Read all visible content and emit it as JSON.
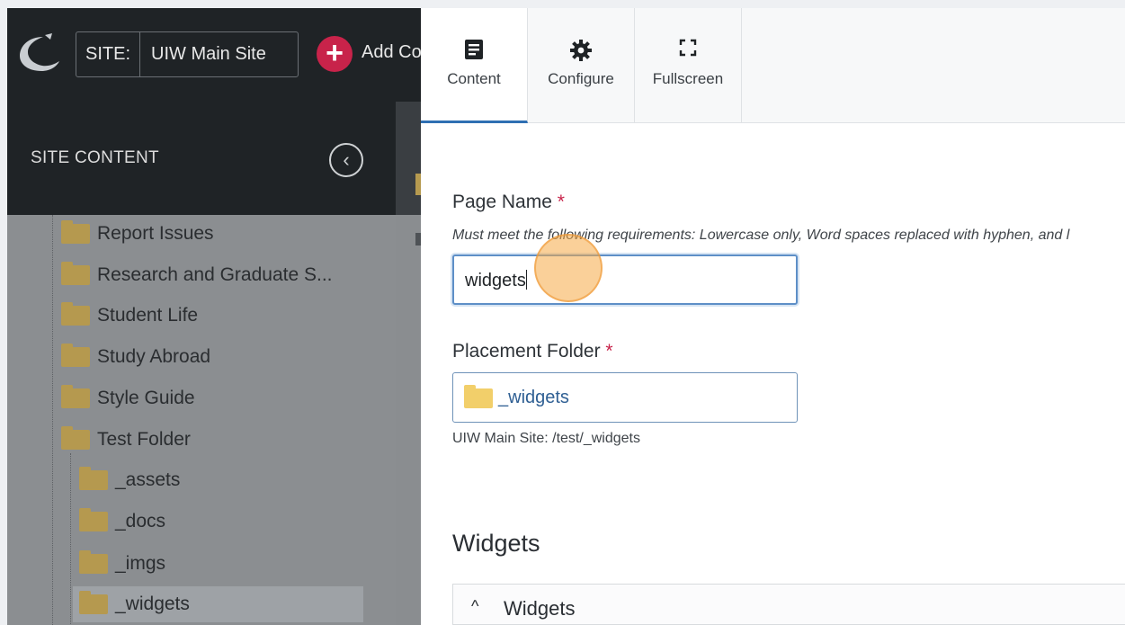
{
  "topbar": {
    "site_prefix": "SITE:",
    "site_name": "UIW Main Site",
    "add_label": "Add Content"
  },
  "site_content": {
    "title": "SITE CONTENT",
    "items": [
      {
        "label": "Report Issues",
        "level": 1,
        "selected": false
      },
      {
        "label": "Research and Graduate S...",
        "level": 1,
        "selected": false
      },
      {
        "label": "Student Life",
        "level": 1,
        "selected": false
      },
      {
        "label": "Study Abroad",
        "level": 1,
        "selected": false
      },
      {
        "label": "Style Guide",
        "level": 1,
        "selected": false
      },
      {
        "label": "Test Folder",
        "level": 1,
        "selected": false
      },
      {
        "label": "_assets",
        "level": 2,
        "selected": false
      },
      {
        "label": "_docs",
        "level": 2,
        "selected": false
      },
      {
        "label": "_imgs",
        "level": 2,
        "selected": false
      },
      {
        "label": "_widgets",
        "level": 2,
        "selected": true
      }
    ]
  },
  "panel": {
    "tabs": [
      {
        "label": "Content",
        "icon": "content-icon",
        "active": true
      },
      {
        "label": "Configure",
        "icon": "gear-icon",
        "active": false
      },
      {
        "label": "Fullscreen",
        "icon": "fullscreen-icon",
        "active": false
      }
    ],
    "page_name": {
      "label": "Page Name",
      "required_mark": "*",
      "hint": "Must meet the following requirements: Lowercase only, Word spaces replaced with hyphen, and l",
      "value": "widgets"
    },
    "placement_folder": {
      "label": "Placement Folder",
      "required_mark": "*",
      "value": "_widgets",
      "path": "UIW Main Site: /test/_widgets"
    },
    "section_title": "Widgets",
    "accordion_label": "Widgets"
  },
  "colors": {
    "topbar": "#1f2326",
    "accent_add": "#c8234a",
    "active_tab_underline": "#2f6fb3",
    "folder_yellow": "#f2cf6a"
  }
}
